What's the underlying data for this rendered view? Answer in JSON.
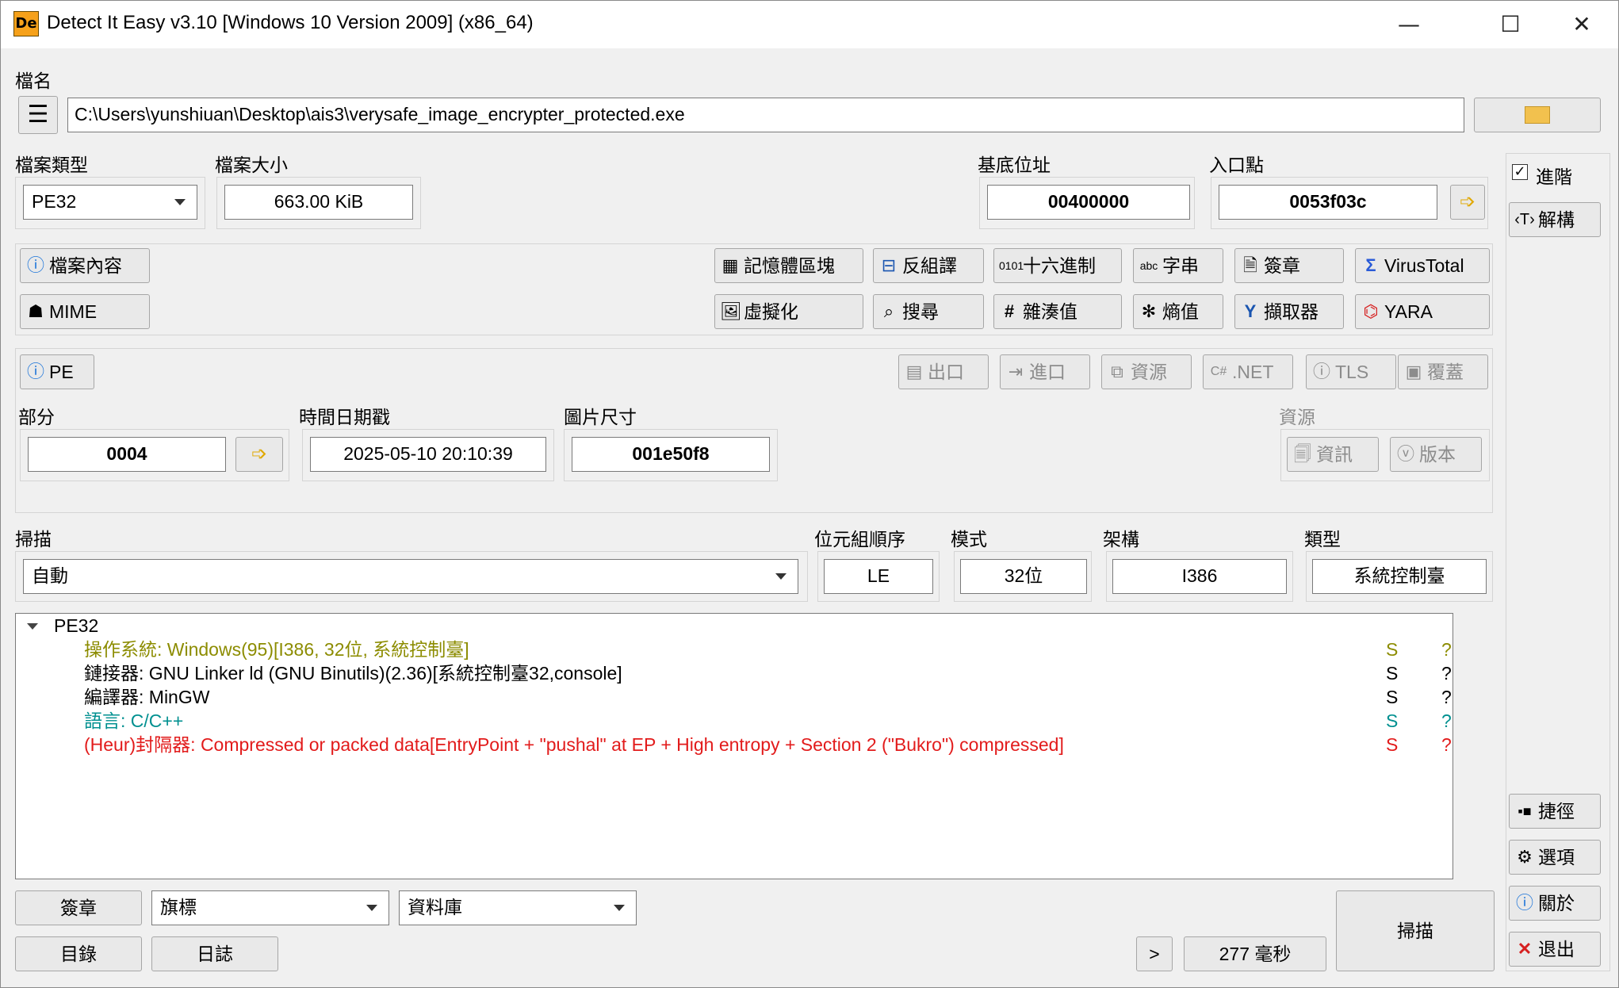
{
  "window": {
    "title": "Detect It Easy v3.10 [Windows 10 Version 2009] (x86_64)",
    "icon_text": "De",
    "controls": {
      "minimize": "—",
      "maximize": "☐",
      "close": "✕"
    }
  },
  "file": {
    "label": "檔名",
    "path": "C:\\Users\\yunshiuan\\Desktop\\ais3\\verysafe_image_encrypter_protected.exe"
  },
  "info": {
    "type_label": "檔案類型",
    "type_value": "PE32",
    "size_label": "檔案大小",
    "size_value": "663.00 KiB",
    "base_label": "基底位址",
    "base_value": "00400000",
    "entry_label": "入口點",
    "entry_value": "0053f03c"
  },
  "right_panel": {
    "advanced_label": "進階",
    "disasm_label": "解構",
    "shortcut_label": "捷徑",
    "options_label": "選項",
    "about_label": "關於",
    "exit_label": "退出"
  },
  "tools": {
    "file_content": "檔案內容",
    "mime": "MIME",
    "memory_map": "記憶體區塊",
    "disassembly": "反組譯",
    "hex": "十六進制",
    "strings": "字串",
    "signatures": "簽章",
    "virustotal": "VirusTotal",
    "visualization": "虛擬化",
    "search": "搜尋",
    "hash": "雜湊值",
    "entropy": "熵值",
    "extractor": "擷取器",
    "yara": "YARA"
  },
  "pe": {
    "pe_button": "PE",
    "export": "出口",
    "import": "進口",
    "resources": "資源",
    "dotnet": ".NET",
    "tls": "TLS",
    "overlay": "覆蓋",
    "section_label": "部分",
    "section_value": "0004",
    "time_label": "時間日期戳",
    "time_value": "2025-05-10 20:10:39",
    "image_label": "圖片尺寸",
    "image_value": "001e50f8",
    "res_label": "資源",
    "res_info": "資訊",
    "res_version": "版本"
  },
  "scan": {
    "label": "掃描",
    "mode": "自動",
    "endian_label": "位元組順序",
    "endian_value": "LE",
    "mode_label": "模式",
    "mode_value": "32位",
    "arch_label": "架構",
    "arch_value": "I386",
    "type_label": "類型",
    "type_value": "系統控制臺"
  },
  "results": {
    "root": "PE32",
    "rows": [
      {
        "text": "操作系統: Windows(95)[I386, 32位, 系統控制臺]",
        "s": "S",
        "q": "?",
        "color": "#8c8c00"
      },
      {
        "text": "鏈接器: GNU Linker ld (GNU Binutils)(2.36)[系統控制臺32,console]",
        "s": "S",
        "q": "?",
        "color": "#000000"
      },
      {
        "text": "編譯器: MinGW",
        "s": "S",
        "q": "?",
        "color": "#000000"
      },
      {
        "text": "語言: C/C++",
        "s": "S",
        "q": "?",
        "color": "#009090"
      },
      {
        "text": "(Heur)封隔器: Compressed or packed data[EntryPoint + \"pushal\" at EP + High entropy + Section 2 (\"Bukro\") compressed]",
        "s": "S",
        "q": "?",
        "color": "#e21b1b"
      }
    ]
  },
  "bottom": {
    "signatures": "簽章",
    "flags": "旗標",
    "database": "資料庫",
    "directory": "目錄",
    "log": "日誌",
    "more": ">",
    "time": "277 毫秒",
    "scan": "掃描"
  }
}
